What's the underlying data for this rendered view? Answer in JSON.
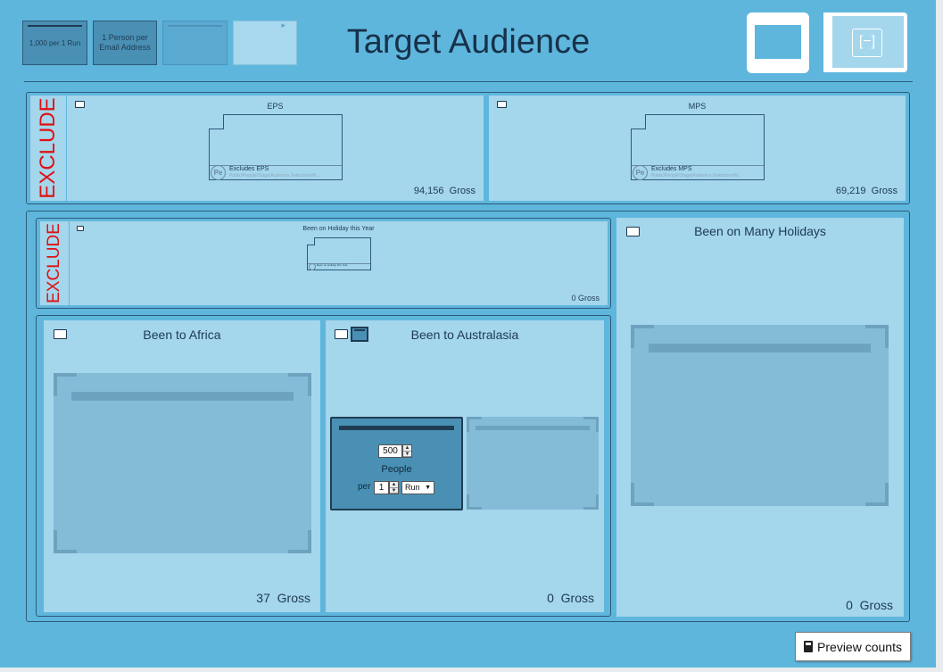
{
  "header": {
    "title": "Target Audience",
    "toolbar": {
      "btn1_label": "1,000 per 1 Run",
      "btn2_label": "1 Person per Email Address"
    }
  },
  "top_group": {
    "exclude_label": "EXCLUDE",
    "cards": [
      {
        "title": "EPS",
        "doc_title": "Excludes EPS",
        "doc_path": "Public\\People\\Stage\\Audience Selections\\M...",
        "pe": "Pe",
        "gross": "94,156",
        "gross_unit": "Gross"
      },
      {
        "title": "MPS",
        "doc_title": "Excludes MPS",
        "doc_path": "Public\\People\\Stage\\Audience Selections\\M...",
        "pe": "Pe",
        "gross": "69,219",
        "gross_unit": "Gross"
      }
    ]
  },
  "main_group": {
    "exclude_label": "EXCLUDE",
    "holiday_card": {
      "title": "Been on Holiday this Year",
      "doc_title": "Been on Holiday this Year",
      "gross": "0",
      "gross_unit": "Gross"
    },
    "africa": {
      "title": "Been to Africa",
      "gross": "37",
      "gross_unit": "Gross"
    },
    "australasia": {
      "title": "Been to Australasia",
      "gross": "0",
      "gross_unit": "Gross",
      "limit": {
        "value": "500",
        "people_label": "People",
        "per_label": "per",
        "per_value": "1",
        "unit": "Run"
      }
    },
    "many_holidays": {
      "title": "Been on Many Holidays",
      "gross": "0",
      "gross_unit": "Gross"
    }
  },
  "footer": {
    "preview_label": "Preview counts",
    "preview_icon": "calculator-icon"
  }
}
